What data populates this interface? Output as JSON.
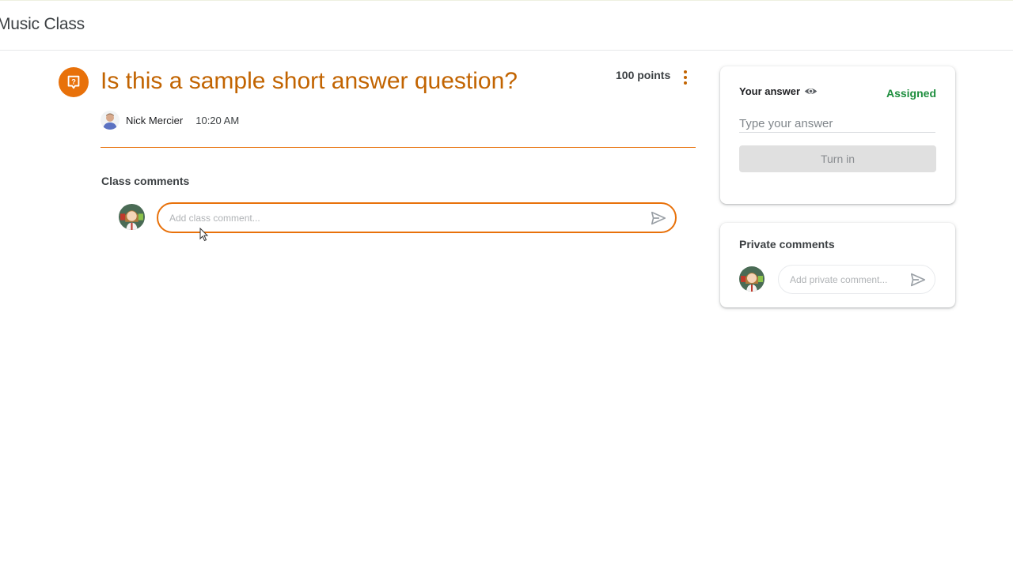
{
  "header": {
    "title": "Music Class"
  },
  "assignment": {
    "icon": "question-icon",
    "title": "Is this a sample short answer question?",
    "points": "100 points",
    "author": "Nick Mercier",
    "time": "10:20 AM",
    "accent_color": "#e8710a"
  },
  "class_comments": {
    "label": "Class comments",
    "placeholder": "Add class comment..."
  },
  "your_answer": {
    "label": "Your answer",
    "status": "Assigned",
    "status_color": "#1e8e3e",
    "placeholder": "Type your answer",
    "turn_in_label": "Turn in"
  },
  "private_comments": {
    "label": "Private comments",
    "placeholder": "Add private comment..."
  }
}
